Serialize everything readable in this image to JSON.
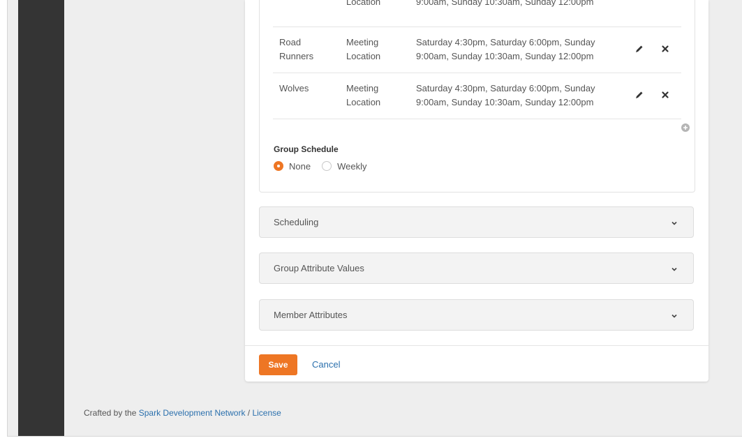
{
  "locations": [
    {
      "name": "",
      "type": "Location",
      "schedule": "9:00am, Sunday 10:30am, Sunday 12:00pm"
    },
    {
      "name": "Road Runners",
      "type": "Meeting Location",
      "schedule": "Saturday 4:30pm, Saturday 6:00pm, Sunday 9:00am, Sunday 10:30am, Sunday 12:00pm",
      "edit_icon": "pencil-icon",
      "delete_icon": "close-icon"
    },
    {
      "name": "Wolves",
      "type": "Meeting Location",
      "schedule": "Saturday 4:30pm, Saturday 6:00pm, Sunday 9:00am, Sunday 10:30am, Sunday 12:00pm",
      "edit_icon": "pencil-icon",
      "delete_icon": "close-icon"
    }
  ],
  "add_icon": "plus-circle-icon",
  "group_schedule": {
    "label": "Group Schedule",
    "options": [
      {
        "label": "None",
        "selected": true
      },
      {
        "label": "Weekly",
        "selected": false
      }
    ]
  },
  "accordions": [
    {
      "title": "Scheduling",
      "icon": "chevron-down-icon"
    },
    {
      "title": "Group Attribute Values",
      "icon": "chevron-down-icon"
    },
    {
      "title": "Member Attributes",
      "icon": "chevron-down-icon"
    }
  ],
  "actions": {
    "save_label": "Save",
    "cancel_label": "Cancel"
  },
  "footer": {
    "prefix": "Crafted by the ",
    "link_text": "Spark Development Network",
    "separator": " / ",
    "license_text": "License"
  },
  "colors": {
    "accent": "#ee7624",
    "link": "#2b70ad",
    "sidebar": "#343434",
    "page_background": "#eeeeee"
  }
}
